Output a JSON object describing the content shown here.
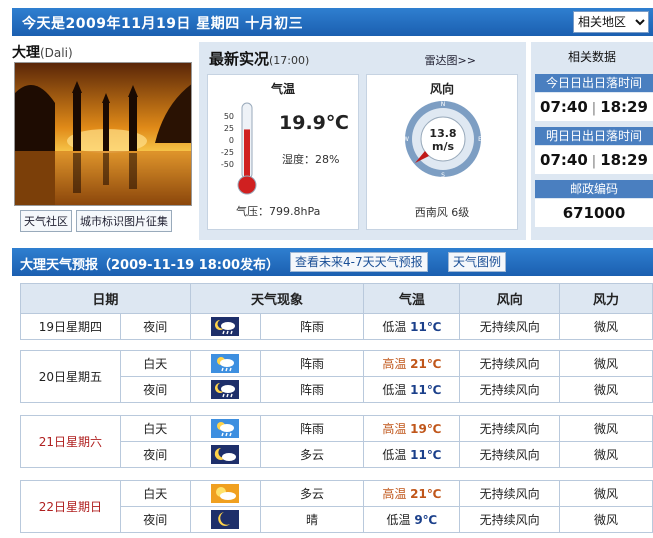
{
  "header": {
    "title": "今天是2009年11月19日  星期四  十月初三",
    "region_select": "相关地区"
  },
  "photo_panel": {
    "city": "大理",
    "city_en": "(Dali)",
    "links": [
      "天气社区",
      "城市标识图片征集"
    ]
  },
  "current": {
    "title": "最新实况",
    "time": "(17:00)",
    "radar_link": "雷达图>>",
    "temp_caption": "气温",
    "temperature": "19.9℃",
    "humidity": "湿度：28%",
    "pressure": "气压：799.8hPa",
    "thermo_ticks": [
      "50",
      "25",
      "0",
      "-25",
      "-50"
    ],
    "thermo_level_celsius": 19.9,
    "wind_caption": "风向",
    "wind_speed": "13.8",
    "wind_unit": "m/s",
    "compass": {
      "n": "N",
      "s": "S",
      "e": "E",
      "w": "W"
    },
    "wind_desc": "西南风  6级"
  },
  "stats": {
    "title": "相关数据",
    "today_label": "今日日出日落时间",
    "today_sunrise": "07:40",
    "today_sunset": "18:29",
    "tomorrow_label": "明日日出日落时间",
    "tomorrow_sunrise": "07:40",
    "tomorrow_sunset": "18:29",
    "postcode_label": "邮政编码",
    "postcode": "671000",
    "separator": "|"
  },
  "forecast": {
    "title": "大理天气预报（2009-11-19 18:00发布）",
    "btn_more": "查看未来4-7天天气预报",
    "btn_legend": "天气图例",
    "columns": [
      "日期",
      "天气现象",
      "气温",
      "风向",
      "风力"
    ],
    "rows": [
      {
        "date": "19日星期四",
        "weekend": false,
        "periods": [
          {
            "period": "夜间",
            "icon": "night-shower-icon",
            "weather": "阵雨",
            "temp_label": "低温",
            "temp": "11℃",
            "hi": false,
            "wind_dir": "无持续风向",
            "wind_force": "微风"
          }
        ]
      },
      {
        "date": "20日星期五",
        "weekend": false,
        "periods": [
          {
            "period": "白天",
            "icon": "day-shower-icon",
            "weather": "阵雨",
            "temp_label": "高温",
            "temp": "21℃",
            "hi": true,
            "wind_dir": "无持续风向",
            "wind_force": "微风"
          },
          {
            "period": "夜间",
            "icon": "night-shower-icon",
            "weather": "阵雨",
            "temp_label": "低温",
            "temp": "11℃",
            "hi": false,
            "wind_dir": "无持续风向",
            "wind_force": "微风"
          }
        ]
      },
      {
        "date": "21日星期六",
        "weekend": true,
        "periods": [
          {
            "period": "白天",
            "icon": "day-shower-icon",
            "weather": "阵雨",
            "temp_label": "高温",
            "temp": "19℃",
            "hi": true,
            "wind_dir": "无持续风向",
            "wind_force": "微风"
          },
          {
            "period": "夜间",
            "icon": "night-cloudy-icon",
            "weather": "多云",
            "temp_label": "低温",
            "temp": "11℃",
            "hi": false,
            "wind_dir": "无持续风向",
            "wind_force": "微风"
          }
        ]
      },
      {
        "date": "22日星期日",
        "weekend": true,
        "periods": [
          {
            "period": "白天",
            "icon": "day-cloudy-icon",
            "weather": "多云",
            "temp_label": "高温",
            "temp": "21℃",
            "hi": true,
            "wind_dir": "无持续风向",
            "wind_force": "微风"
          },
          {
            "period": "夜间",
            "icon": "night-clear-icon",
            "weather": "晴",
            "temp_label": "低温",
            "temp": "9℃",
            "hi": false,
            "wind_dir": "无持续风向",
            "wind_force": "微风"
          }
        ]
      }
    ]
  }
}
